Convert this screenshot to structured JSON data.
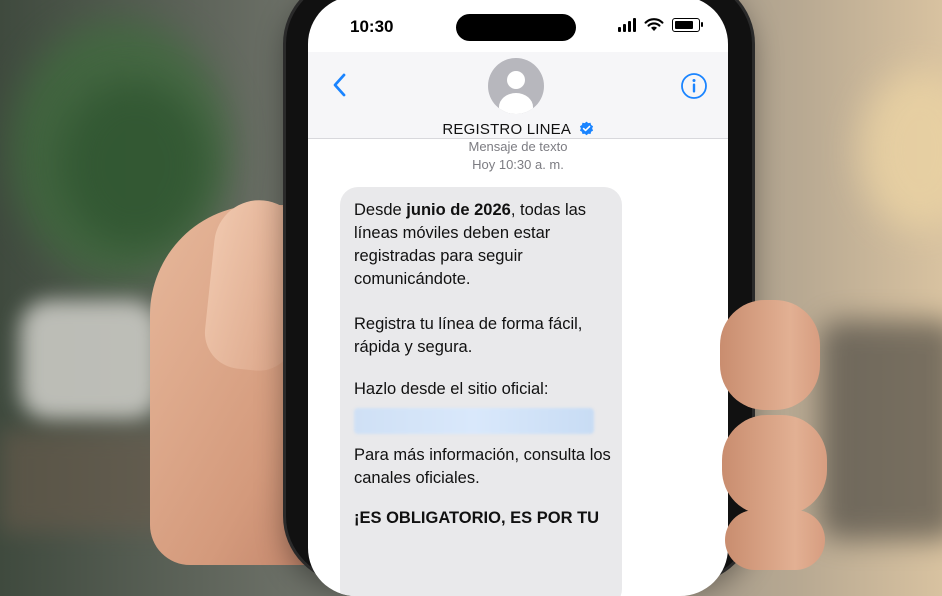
{
  "status_bar": {
    "time": "10:30"
  },
  "header": {
    "contact_name": "REGISTRO LINEA"
  },
  "thread": {
    "message_type": "Mensaje de texto",
    "timestamp": "Hoy 10:30 a. m."
  },
  "message": {
    "p1_pre": "Desde ",
    "p1_bold": "junio de 2026",
    "p1_post": ", todas las líneas móviles deben estar registradas para seguir comunicándote.",
    "p2": "Registra tu línea de forma fácil, rápida y segura.",
    "p3": "Hazlo desde el sitio oficial:",
    "p4": "Para más información, consulta los canales oficiales.",
    "p5": "¡ES OBLIGATORIO, ES POR TU"
  },
  "colors": {
    "accent": "#1a84ff",
    "bubble": "#e9e9eb",
    "verified": "#1a84ff"
  },
  "icons": {
    "back": "chevron-left-icon",
    "info": "info-circle-icon",
    "avatar": "person-silhouette-icon",
    "verified": "verified-badge-icon",
    "signal": "cellular-signal-icon",
    "wifi": "wifi-icon",
    "battery": "battery-icon"
  }
}
